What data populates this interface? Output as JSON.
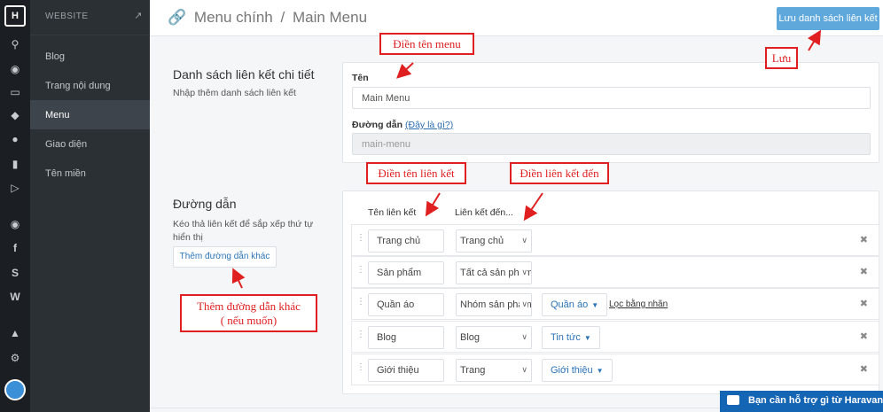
{
  "sidebar": {
    "logo": "H",
    "section_label": "WEBSITE",
    "items": [
      {
        "label": "Blog"
      },
      {
        "label": "Trang nội dung"
      },
      {
        "label": "Menu"
      },
      {
        "label": "Giao diện"
      },
      {
        "label": "Tên miền"
      }
    ]
  },
  "header": {
    "crumb_parent": "Menu chính",
    "crumb_sep": "/",
    "crumb_current": "Main Menu",
    "save_label": "Lưu danh sách liên kết"
  },
  "detail": {
    "title": "Danh sách liên kết chi tiết",
    "desc": "Nhập thêm danh sách liên kết",
    "name_label": "Tên",
    "name_value": "Main Menu",
    "path_label": "Đường dẫn",
    "path_help": "(Đây là gì?)",
    "path_value": "main-menu"
  },
  "links": {
    "title": "Đường dẫn",
    "desc": "Kéo thả liên kết để sắp xếp thứ tự hiển thị",
    "add_label": "Thêm đường dẫn khác",
    "col_name": "Tên liên kết",
    "col_target": "Liên kết đến...",
    "rows": [
      {
        "name": "Trang chủ",
        "target": "Trang chủ",
        "dropdown": "",
        "link": ""
      },
      {
        "name": "Sản phẩm",
        "target": "Tất cả sản phẩm",
        "dropdown": "",
        "link": ""
      },
      {
        "name": "Quần áo",
        "target": "Nhóm sản phẩm",
        "dropdown": "Quần áo",
        "link": "Lọc bằng nhãn"
      },
      {
        "name": "Blog",
        "target": "Blog",
        "dropdown": "Tin tức",
        "link": ""
      },
      {
        "name": "Giới thiệu",
        "target": "Trang",
        "dropdown": "Giới thiệu",
        "link": ""
      }
    ]
  },
  "annotations": {
    "menu_name": "Điền tên menu",
    "save": "Lưu",
    "link_name": "Điền tên liên kết",
    "link_target": "Điền liên kết đến",
    "add_more_1": "Thêm đường dẫn khác",
    "add_more_2": "( nếu muốn)"
  },
  "chat": {
    "label": "Bạn cần hỗ trợ gì từ Haravan?"
  },
  "colors": {
    "accent": "#5fa8dc",
    "annotation": "#e02020",
    "sidebar": "#2b3035"
  }
}
